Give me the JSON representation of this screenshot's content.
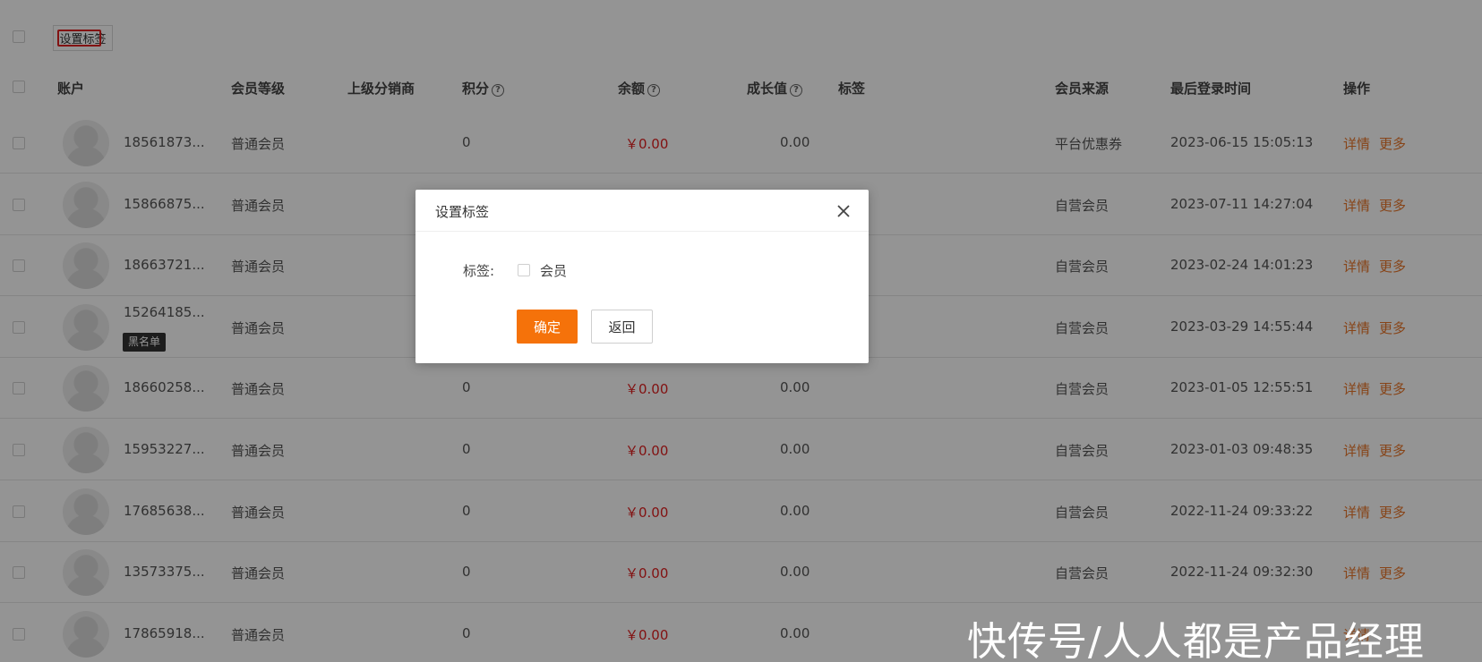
{
  "toolbar": {
    "set_tag_button": "设置标签"
  },
  "table": {
    "headers": {
      "account": "账户",
      "level": "会员等级",
      "distributor": "上级分销商",
      "points": "积分",
      "balance": "余额",
      "growth": "成长值",
      "tags": "标签",
      "source": "会员来源",
      "last_login": "最后登录时间",
      "actions": "操作"
    },
    "help_icon": "?",
    "detail_label": "详情",
    "more_label": "更多",
    "rows": [
      {
        "account": "18561873...",
        "level": "普通会员",
        "points": "0",
        "balance": "￥0.00",
        "growth": "0.00",
        "source": "平台优惠券",
        "last_login": "2023-06-15 15:05:13"
      },
      {
        "account": "15866875...",
        "level": "普通会员",
        "points": "",
        "balance": "",
        "growth": "",
        "source": "自营会员",
        "last_login": "2023-07-11 14:27:04"
      },
      {
        "account": "18663721...",
        "level": "普通会员",
        "points": "",
        "balance": "",
        "growth": "",
        "source": "自营会员",
        "last_login": "2023-02-24 14:01:23"
      },
      {
        "account": "15264185...",
        "level": "普通会员",
        "points": "",
        "balance": "",
        "growth": "",
        "source": "自营会员",
        "last_login": "2023-03-29 14:55:44",
        "badge": "黑名单"
      },
      {
        "account": "18660258...",
        "level": "普通会员",
        "points": "0",
        "balance": "￥0.00",
        "growth": "0.00",
        "source": "自营会员",
        "last_login": "2023-01-05 12:55:51"
      },
      {
        "account": "15953227...",
        "level": "普通会员",
        "points": "0",
        "balance": "￥0.00",
        "growth": "0.00",
        "source": "自营会员",
        "last_login": "2023-01-03 09:48:35"
      },
      {
        "account": "17685638...",
        "level": "普通会员",
        "points": "0",
        "balance": "￥0.00",
        "growth": "0.00",
        "source": "自营会员",
        "last_login": "2022-11-24 09:33:22"
      },
      {
        "account": "13573375...",
        "level": "普通会员",
        "points": "0",
        "balance": "￥0.00",
        "growth": "0.00",
        "source": "自营会员",
        "last_login": "2022-11-24 09:32:30"
      },
      {
        "account": "17865918...",
        "level": "普通会员",
        "points": "0",
        "balance": "￥0.00",
        "growth": "0.00",
        "source": "",
        "last_login": "",
        "more_label": ""
      }
    ]
  },
  "dialog": {
    "title": "设置标签",
    "field_label": "标签:",
    "option_label": "会员",
    "option_checked": false,
    "ok_label": "确定",
    "back_label": "返回"
  },
  "watermark": "快传号/人人都是产品经理",
  "colors": {
    "accent": "#f5720a",
    "price": "#e02020",
    "link": "#e8762a"
  }
}
